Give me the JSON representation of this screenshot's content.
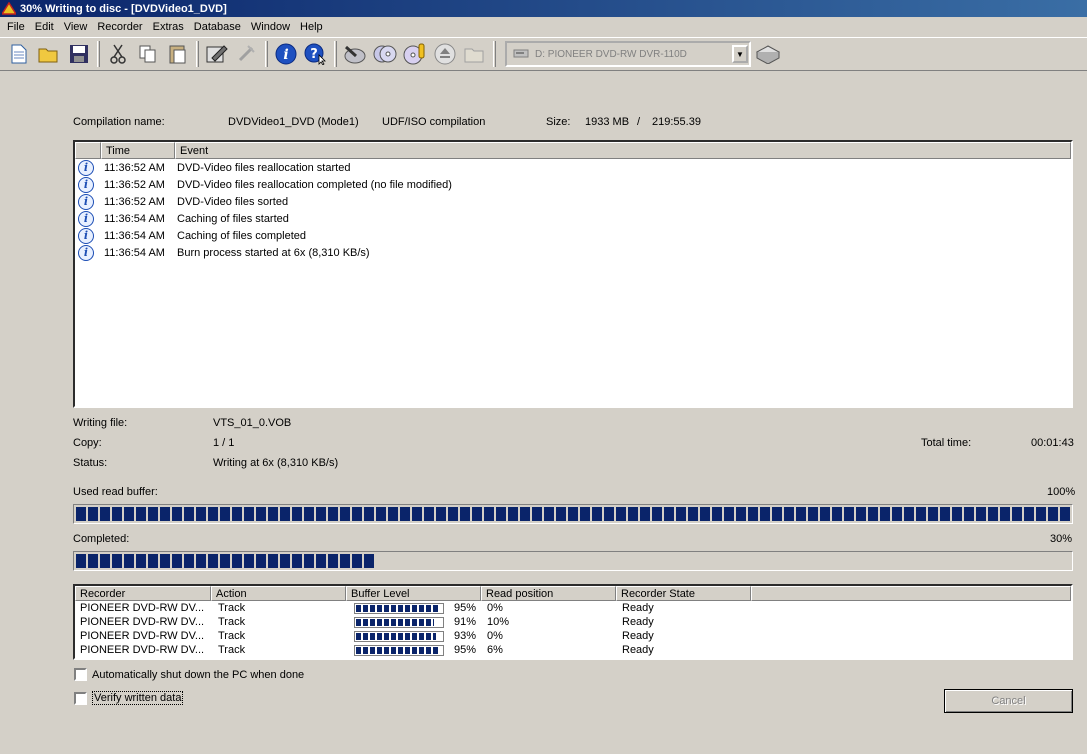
{
  "window": {
    "title": "30% Writing to disc - [DVDVideo1_DVD]"
  },
  "menu": [
    "File",
    "Edit",
    "View",
    "Recorder",
    "Extras",
    "Database",
    "Window",
    "Help"
  ],
  "toolbar": {
    "drive": "D: PIONEER  DVD-RW  DVR-110D"
  },
  "compilation": {
    "name_label": "Compilation name:",
    "name": "DVDVideo1_DVD (Mode1)",
    "type": "UDF/ISO compilation",
    "size_label": "Size:",
    "size_mb": "1933 MB",
    "separator": "/",
    "duration": "219:55.39"
  },
  "log": {
    "columns": [
      "Time",
      "Event"
    ],
    "rows": [
      {
        "time": "11:36:52 AM",
        "event": "DVD-Video files reallocation started"
      },
      {
        "time": "11:36:52 AM",
        "event": "DVD-Video files reallocation completed (no file modified)"
      },
      {
        "time": "11:36:52 AM",
        "event": "DVD-Video files sorted"
      },
      {
        "time": "11:36:54 AM",
        "event": "Caching of files started"
      },
      {
        "time": "11:36:54 AM",
        "event": "Caching of files completed"
      },
      {
        "time": "11:36:54 AM",
        "event": "Burn process started at 6x (8,310 KB/s)"
      }
    ]
  },
  "status": {
    "writing_file_label": "Writing file:",
    "writing_file": "VTS_01_0.VOB",
    "copy_label": "Copy:",
    "copy": "1 / 1",
    "total_time_label": "Total time:",
    "total_time": "00:01:43",
    "status_label": "Status:",
    "status": "Writing at 6x (8,310 KB/s)"
  },
  "buffer": {
    "label": "Used read buffer:",
    "percent_text": "100%",
    "fraction": 1.0
  },
  "completed": {
    "label": "Completed:",
    "percent_text": "30%",
    "fraction": 0.3
  },
  "recorders": {
    "columns": [
      "Recorder",
      "Action",
      "Buffer Level",
      "Read position",
      "Recorder State"
    ],
    "rows": [
      {
        "recorder": "PIONEER DVD-RW  DV...",
        "action": "Track",
        "buffer_text": "95%",
        "buffer": 0.95,
        "read": "0%",
        "state": "Ready"
      },
      {
        "recorder": "PIONEER DVD-RW  DV...",
        "action": "Track",
        "buffer_text": "91%",
        "buffer": 0.91,
        "read": "10%",
        "state": "Ready"
      },
      {
        "recorder": "PIONEER DVD-RW  DV...",
        "action": "Track",
        "buffer_text": "93%",
        "buffer": 0.93,
        "read": "0%",
        "state": "Ready"
      },
      {
        "recorder": "PIONEER DVD-RW  DV...",
        "action": "Track",
        "buffer_text": "95%",
        "buffer": 0.95,
        "read": "6%",
        "state": "Ready"
      }
    ]
  },
  "options": {
    "shutdown": "Automatically shut down the PC when done",
    "verify": "Verify written data"
  },
  "cancel_label": "Cancel"
}
